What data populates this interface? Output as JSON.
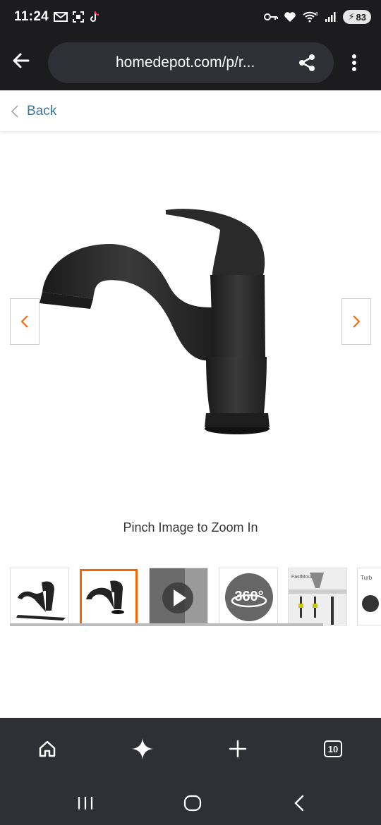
{
  "status_bar": {
    "time": "11:24",
    "battery": "83",
    "wifi_label": "6"
  },
  "browser": {
    "url": "homedepot.com/p/r...",
    "tab_count": "10"
  },
  "page": {
    "back_label": "Back",
    "zoom_hint": "Pinch Image to Zoom In"
  },
  "thumbnails": [
    {
      "name": "faucet-angle-view"
    },
    {
      "name": "faucet-side-view"
    },
    {
      "name": "product-video"
    },
    {
      "name": "360-view",
      "label": "360°"
    },
    {
      "name": "fastmount-install",
      "label": "FastMount"
    },
    {
      "name": "turbo-spray",
      "label": "Turb"
    }
  ],
  "colors": {
    "accent": "#f96302",
    "link": "#3e7697",
    "chrome_dark": "#1c1c1e",
    "toolbar": "#2f3035"
  }
}
